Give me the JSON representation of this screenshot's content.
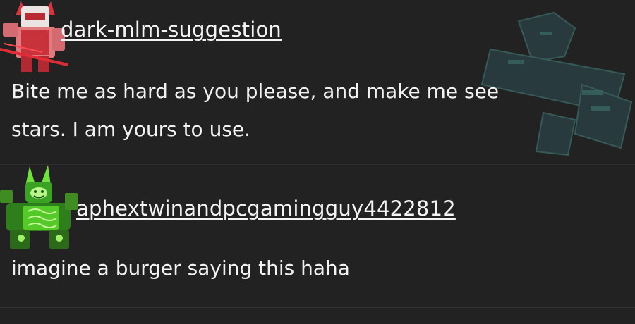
{
  "posts": [
    {
      "username": "dark-mlm-suggestion",
      "text": "Bite me as hard as you please, and make me see\nstars. I am yours to use."
    },
    {
      "username": "aphextwinandpcgamingguy4422812",
      "text": "imagine a burger saying this haha"
    }
  ],
  "colors": {
    "background": "#222223",
    "text": "#f2f2f2",
    "divider": "#2f2f30",
    "avatar1_primary": "#c8323b",
    "avatar2_primary": "#4fd62a",
    "deco_primary": "#38b7b0"
  },
  "icons": {
    "avatar1": "red-robot-avatar-icon",
    "avatar2": "green-robot-avatar-icon",
    "decoration": "robot-figure-icon"
  }
}
